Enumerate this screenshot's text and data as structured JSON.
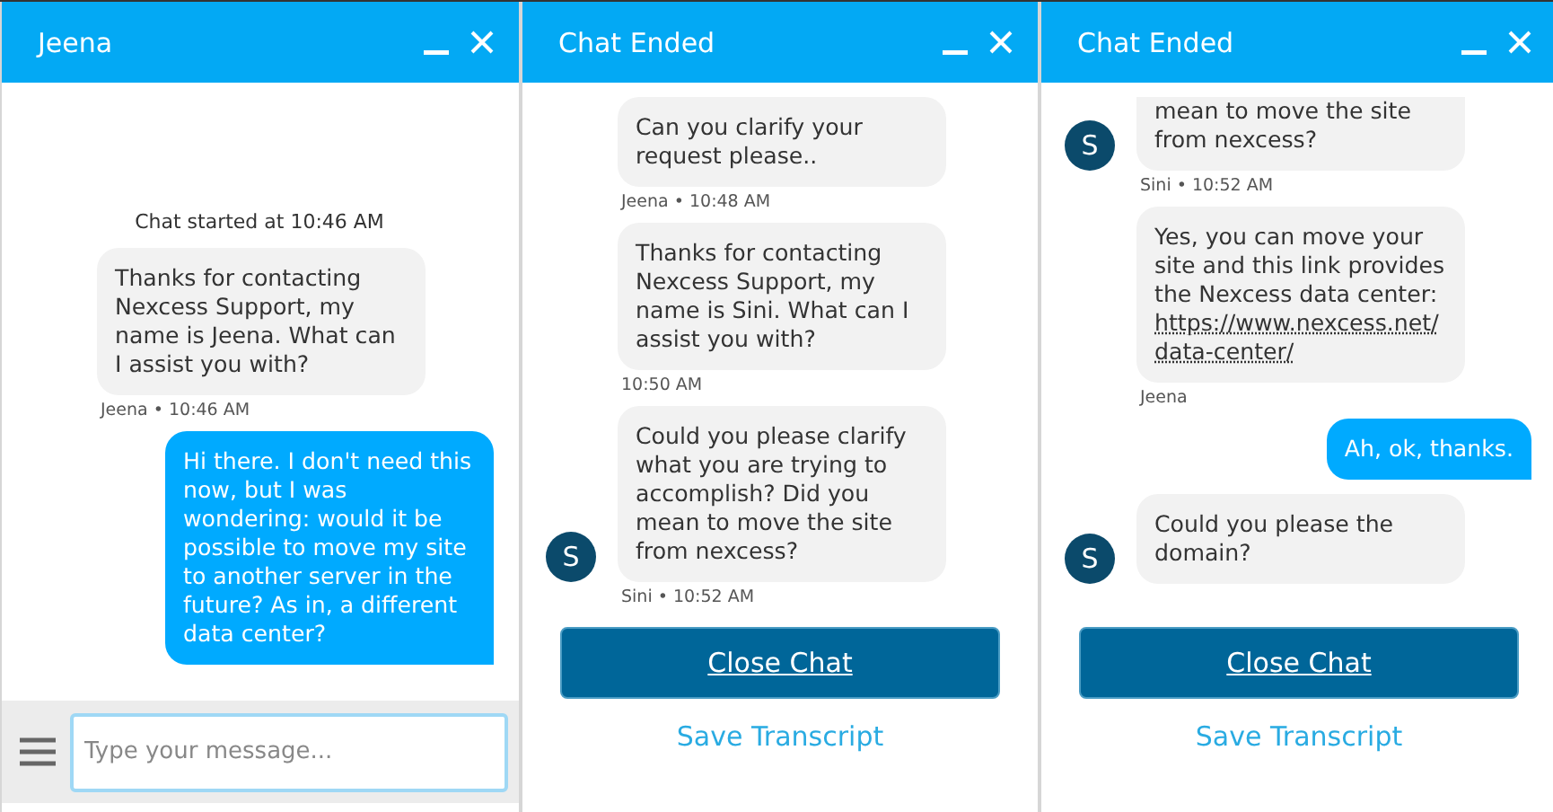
{
  "panels": [
    {
      "title": "Jeena",
      "messages": [
        {
          "kind": "notice",
          "text": "Chat started at 10:46 AM"
        },
        {
          "kind": "agent",
          "text": "Thanks for contacting Nexcess Support, my name is Jeena. What can I assist you with?"
        },
        {
          "kind": "meta",
          "text": "Jeena • 10:46 AM"
        },
        {
          "kind": "user",
          "text": "Hi there. I don't need this now, but I was wondering: would it be possible to move my site to another server in the future? As in, a different data center?"
        }
      ],
      "footer": {
        "kind": "composer",
        "placeholder": "Type your message..."
      }
    },
    {
      "title": "Chat Ended",
      "messages": [
        {
          "kind": "agent",
          "text": "Can you clarify your request please.."
        },
        {
          "kind": "meta",
          "text": "Jeena • 10:48 AM"
        },
        {
          "kind": "agent",
          "text": "Thanks for contacting Nexcess Support, my name is Sini. What can I assist you with?"
        },
        {
          "kind": "meta",
          "text": "10:50 AM"
        },
        {
          "kind": "agent",
          "text": "Could you please clarify what you are trying to accomplish? Did you mean to move the site from nexcess?",
          "avatar": "S"
        },
        {
          "kind": "meta",
          "text": "Sini • 10:52 AM"
        }
      ],
      "footer": {
        "kind": "ended",
        "button": "Close Chat",
        "link": "Save Transcript"
      }
    },
    {
      "title": "Chat Ended",
      "messages": [
        {
          "kind": "agent",
          "text": "mean to move the site from nexcess?",
          "avatar": "S",
          "cut": true
        },
        {
          "kind": "meta",
          "text": "Sini • 10:52 AM"
        },
        {
          "kind": "agent",
          "text": "Yes, you can move your site and this link provides the Nexcess data center:",
          "link": "https://www.nexcess.net/data-center/"
        },
        {
          "kind": "meta",
          "text": "Jeena"
        },
        {
          "kind": "user",
          "text": "Ah, ok, thanks."
        },
        {
          "kind": "agent",
          "text": "Could you please the domain?",
          "avatar": "S"
        }
      ],
      "footer": {
        "kind": "ended",
        "button": "Close Chat",
        "link": "Save Transcript"
      }
    }
  ]
}
